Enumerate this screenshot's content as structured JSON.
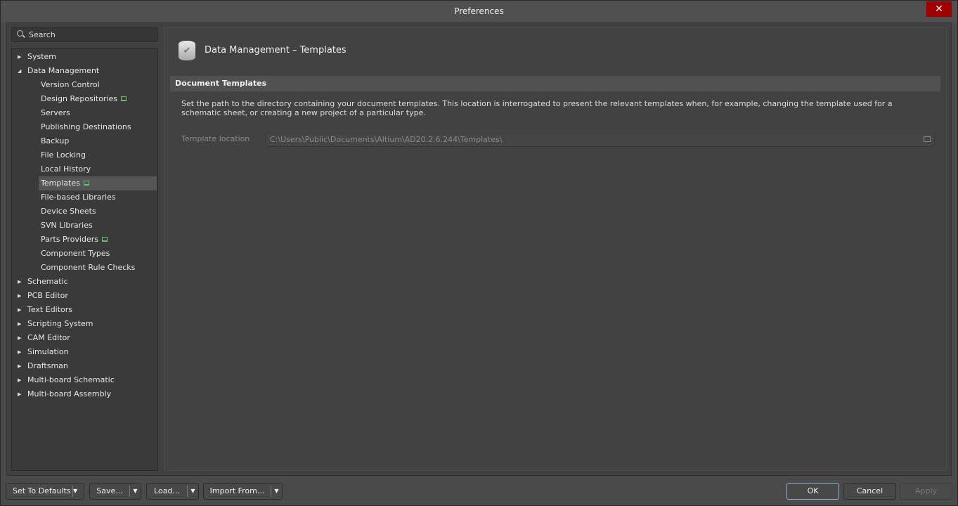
{
  "window": {
    "title": "Preferences",
    "close": "✕"
  },
  "search": {
    "placeholder": "Search"
  },
  "tree": [
    {
      "label": "System",
      "level": 0,
      "expanded": false
    },
    {
      "label": "Data Management",
      "level": 0,
      "expanded": true
    },
    {
      "label": "Version Control",
      "level": 1
    },
    {
      "label": "Design Repositories",
      "level": 1,
      "net": true
    },
    {
      "label": "Servers",
      "level": 1
    },
    {
      "label": "Publishing Destinations",
      "level": 1
    },
    {
      "label": "Backup",
      "level": 1
    },
    {
      "label": "File Locking",
      "level": 1
    },
    {
      "label": "Local History",
      "level": 1
    },
    {
      "label": "Templates",
      "level": 1,
      "net": true,
      "selected": true
    },
    {
      "label": "File-based Libraries",
      "level": 1
    },
    {
      "label": "Device Sheets",
      "level": 1
    },
    {
      "label": "SVN Libraries",
      "level": 1
    },
    {
      "label": "Parts Providers",
      "level": 1,
      "net": true
    },
    {
      "label": "Component Types",
      "level": 1
    },
    {
      "label": "Component Rule Checks",
      "level": 1
    },
    {
      "label": "Schematic",
      "level": 0,
      "expanded": false
    },
    {
      "label": "PCB Editor",
      "level": 0,
      "expanded": false
    },
    {
      "label": "Text Editors",
      "level": 0,
      "expanded": false
    },
    {
      "label": "Scripting System",
      "level": 0,
      "expanded": false
    },
    {
      "label": "CAM Editor",
      "level": 0,
      "expanded": false
    },
    {
      "label": "Simulation",
      "level": 0,
      "expanded": false
    },
    {
      "label": "Draftsman",
      "level": 0,
      "expanded": false
    },
    {
      "label": "Multi-board Schematic",
      "level": 0,
      "expanded": false
    },
    {
      "label": "Multi-board Assembly",
      "level": 0,
      "expanded": false
    }
  ],
  "content": {
    "title": "Data Management – Templates",
    "section": "Document Templates",
    "description": "Set the path to the directory containing your document templates. This location is interrogated to present the relevant templates when, for example, changing the template used for a schematic sheet, or creating a new project of a particular type.",
    "template_location_label": "Template location",
    "template_location_value": "C:\\Users\\Public\\Documents\\Altium\\AD20.2.6.244\\Templates\\"
  },
  "footer": {
    "set_defaults": "Set To Defaults",
    "save": "Save...",
    "load": "Load...",
    "import": "Import From...",
    "ok": "OK",
    "cancel": "Cancel",
    "apply": "Apply"
  }
}
